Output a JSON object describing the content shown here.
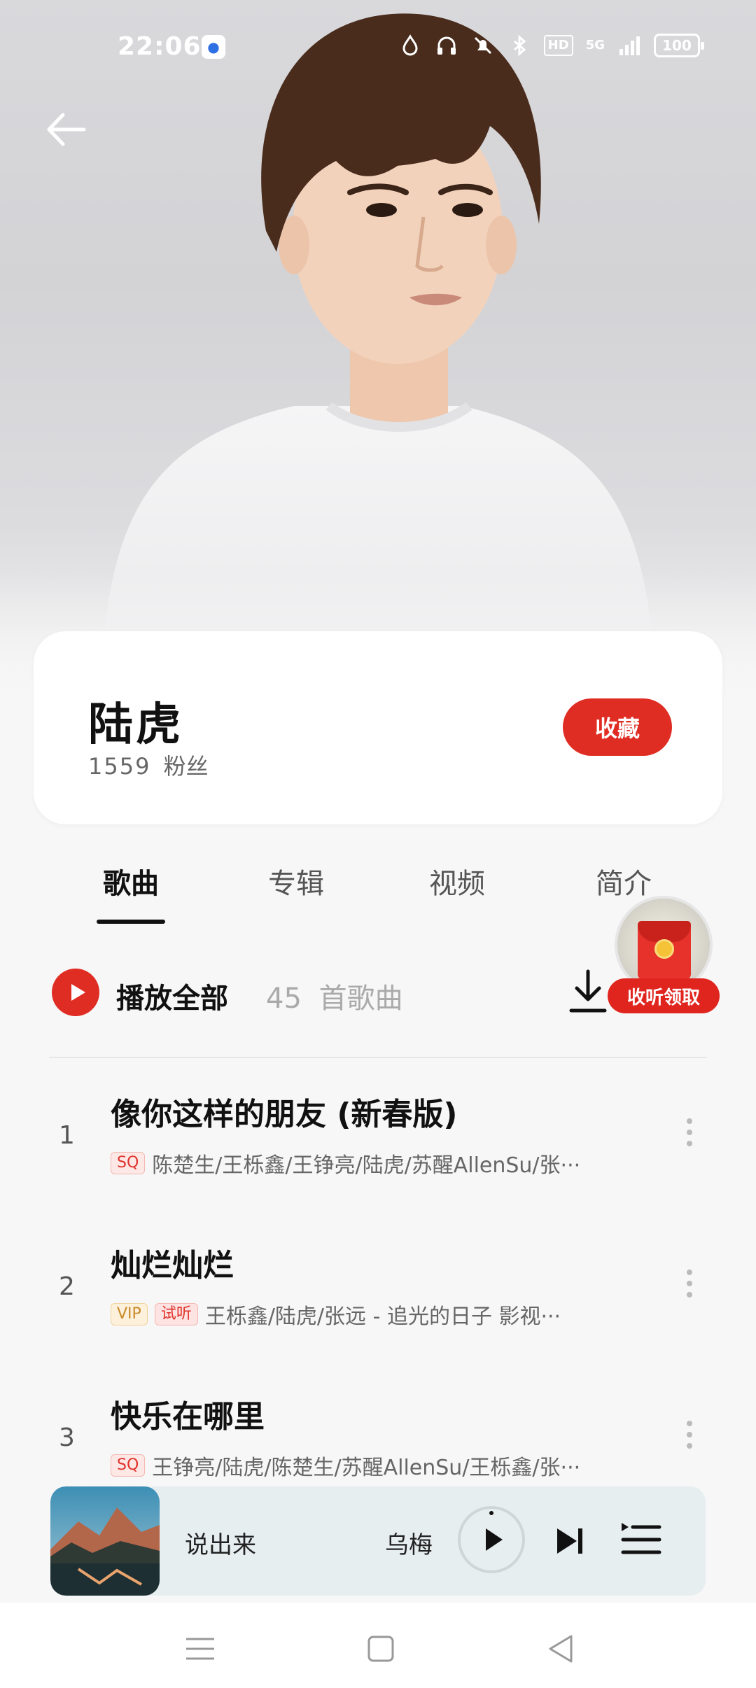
{
  "status_bar": {
    "time": "22:06",
    "hd_label": "HD",
    "network_label": "5G",
    "battery": "100",
    "icons": [
      "baidu-app-icon",
      "drop-icon",
      "headphones-icon",
      "mute-bell-icon",
      "bluetooth-icon",
      "signal-icon"
    ]
  },
  "header": {
    "back_icon": "back-arrow-icon"
  },
  "artist": {
    "name": "陆虎",
    "fans_count": "1559",
    "fans_label": "粉丝",
    "collect_label": "收藏"
  },
  "tabs": [
    {
      "label": "歌曲",
      "active": true
    },
    {
      "label": "专辑",
      "active": false
    },
    {
      "label": "视频",
      "active": false
    },
    {
      "label": "简介",
      "active": false
    }
  ],
  "promo": {
    "label": "收听领取",
    "icon": "red-envelope-icon"
  },
  "play_all": {
    "label": "播放全部",
    "count": "45",
    "count_unit": "首歌曲",
    "download_icon": "download-icon"
  },
  "songs": [
    {
      "index": "1",
      "title": "像你这样的朋友 (新春版)",
      "tags": [
        "SQ"
      ],
      "artists": "陈楚生/王栎鑫/王铮亮/陆虎/苏醒AllenSu/张···"
    },
    {
      "index": "2",
      "title": "灿烂灿烂",
      "tags": [
        "VIP",
        "试听"
      ],
      "artists": "王栎鑫/陆虎/张远 - 追光的日子 影视···"
    },
    {
      "index": "3",
      "title": "快乐在哪里",
      "tags": [
        "SQ"
      ],
      "artists": "王铮亮/陆虎/陈楚生/苏醒AllenSu/王栎鑫/张···"
    }
  ],
  "mini_player": {
    "title": "说出来",
    "artist": "乌梅",
    "play_icon": "play-icon",
    "next_icon": "next-track-icon",
    "queue_icon": "playlist-icon"
  },
  "nav_bar": {
    "icons": [
      "menu-icon",
      "home-square-icon",
      "back-triangle-icon"
    ]
  },
  "colors": {
    "accent_red": "#e02d24",
    "tag_vip": "#c98a2a",
    "mini_player_bg": "#e7eef0"
  }
}
